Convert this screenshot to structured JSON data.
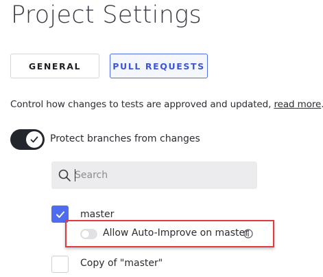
{
  "header": {
    "title": "Project Settings"
  },
  "tabs": [
    {
      "label": "GENERAL",
      "active": false
    },
    {
      "label": "PULL REQUESTS",
      "active": true
    }
  ],
  "description": {
    "text": "Control how changes to tests are approved and updated,",
    "link_text": "read more",
    "trailing": "."
  },
  "protect_branches": {
    "label": "Protect branches from changes",
    "enabled": true
  },
  "search": {
    "placeholder": "Search",
    "value": "",
    "icon": "search-icon"
  },
  "branches": [
    {
      "name": "master",
      "checked": true,
      "auto_improve": {
        "label": "Allow Auto-Improve on master",
        "enabled": false,
        "icon": "info-icon"
      }
    },
    {
      "name": "Copy of \"master\"",
      "checked": false
    }
  ],
  "colors": {
    "accent": "#4e6cf0",
    "highlight": "#e0393e",
    "toggle_on": "#24262e"
  }
}
